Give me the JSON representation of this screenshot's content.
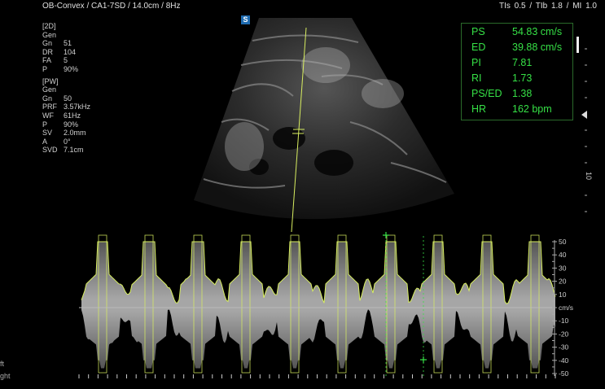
{
  "header": {
    "probe_info": "OB-Convex / CA1-7SD / 14.0cm / 8Hz",
    "indices": "TIs  0.5 / TIb  1.8 / MI    1.0"
  },
  "mode_badge": "S",
  "params_2d": {
    "title": "[2D]",
    "rows": [
      {
        "k": "Gen",
        "v": ""
      },
      {
        "k": "Gn",
        "v": "51"
      },
      {
        "k": "DR",
        "v": "104"
      },
      {
        "k": "FA",
        "v": "5"
      },
      {
        "k": "P",
        "v": "90%"
      }
    ]
  },
  "params_pw": {
    "title": "[PW]",
    "rows": [
      {
        "k": "Gen",
        "v": ""
      },
      {
        "k": "Gn",
        "v": "50"
      },
      {
        "k": "PRF",
        "v": "3.57kHz"
      },
      {
        "k": "WF",
        "v": "61Hz"
      },
      {
        "k": "P",
        "v": "90%"
      },
      {
        "k": "SV",
        "v": "2.0mm"
      },
      {
        "k": "A",
        "v": "0°"
      },
      {
        "k": "SVD",
        "v": "7.1cm"
      }
    ]
  },
  "measurements": [
    {
      "label": "PS",
      "value": "54.83 cm/s"
    },
    {
      "label": "ED",
      "value": "39.88 cm/s"
    },
    {
      "label": "PI",
      "value": "7.81"
    },
    {
      "label": "RI",
      "value": "1.73"
    },
    {
      "label": "PS/ED",
      "value": "1.38"
    },
    {
      "label": "HR",
      "value": "162 bpm"
    }
  ],
  "depth_marker": "10",
  "velocity_scale": {
    "unit": "cm/s",
    "ticks": [
      50,
      40,
      30,
      20,
      10,
      -10,
      -20,
      -30,
      -40,
      -50
    ]
  },
  "bottom_left_labels": [
    "ft",
    "ght"
  ],
  "colors": {
    "measure_green": "#36e046",
    "trace_yellow": "#d8ee60",
    "badge_blue": "#1e6bb0"
  }
}
